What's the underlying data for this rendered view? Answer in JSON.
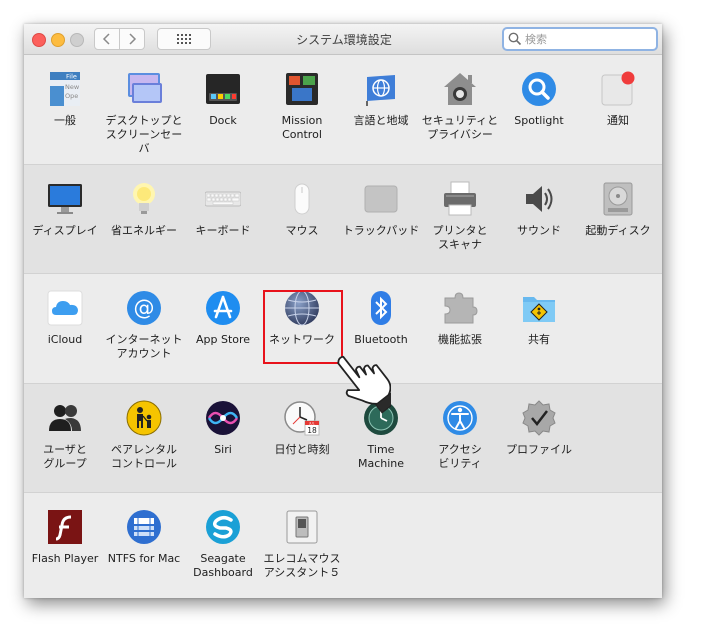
{
  "window": {
    "title": "システム環境設定",
    "search_placeholder": "検索"
  },
  "rows": [
    [
      {
        "id": "general",
        "label": "一般"
      },
      {
        "id": "desktop",
        "label": "デスクトップと\nスクリーンセーバ"
      },
      {
        "id": "dock",
        "label": "Dock"
      },
      {
        "id": "mission",
        "label": "Mission\nControl"
      },
      {
        "id": "language",
        "label": "言語と地域"
      },
      {
        "id": "security",
        "label": "セキュリティと\nプライバシー"
      },
      {
        "id": "spotlight",
        "label": "Spotlight"
      },
      {
        "id": "notifications",
        "label": "通知"
      }
    ],
    [
      {
        "id": "displays",
        "label": "ディスプレイ"
      },
      {
        "id": "energy",
        "label": "省エネルギー"
      },
      {
        "id": "keyboard",
        "label": "キーボード"
      },
      {
        "id": "mouse",
        "label": "マウス"
      },
      {
        "id": "trackpad",
        "label": "トラックパッド"
      },
      {
        "id": "printers",
        "label": "プリンタと\nスキャナ"
      },
      {
        "id": "sound",
        "label": "サウンド"
      },
      {
        "id": "startup",
        "label": "起動ディスク"
      }
    ],
    [
      {
        "id": "icloud",
        "label": "iCloud"
      },
      {
        "id": "internet",
        "label": "インターネット\nアカウント"
      },
      {
        "id": "appstore",
        "label": "App Store"
      },
      {
        "id": "network",
        "label": "ネットワーク"
      },
      {
        "id": "bluetooth",
        "label": "Bluetooth"
      },
      {
        "id": "extensions",
        "label": "機能拡張"
      },
      {
        "id": "sharing",
        "label": "共有"
      }
    ],
    [
      {
        "id": "users",
        "label": "ユーザと\nグループ"
      },
      {
        "id": "parental",
        "label": "ペアレンタル\nコントロール"
      },
      {
        "id": "siri",
        "label": "Siri"
      },
      {
        "id": "datetime",
        "label": "日付と時刻"
      },
      {
        "id": "timemachine",
        "label": "Time\nMachine"
      },
      {
        "id": "accessibility",
        "label": "アクセシ\nビリティ"
      },
      {
        "id": "profiles",
        "label": "プロファイル"
      }
    ],
    [
      {
        "id": "flash",
        "label": "Flash Player"
      },
      {
        "id": "ntfs",
        "label": "NTFS for Mac"
      },
      {
        "id": "seagate",
        "label": "Seagate\nDashboard"
      },
      {
        "id": "elecom",
        "label": "エレコムマウス\nアシスタント５"
      }
    ]
  ],
  "icon_texts": {
    "general_words": [
      "File",
      "New",
      "Ope"
    ],
    "calendar_month": "JUL",
    "calendar_day": "18"
  },
  "highlighted_pane": "network"
}
